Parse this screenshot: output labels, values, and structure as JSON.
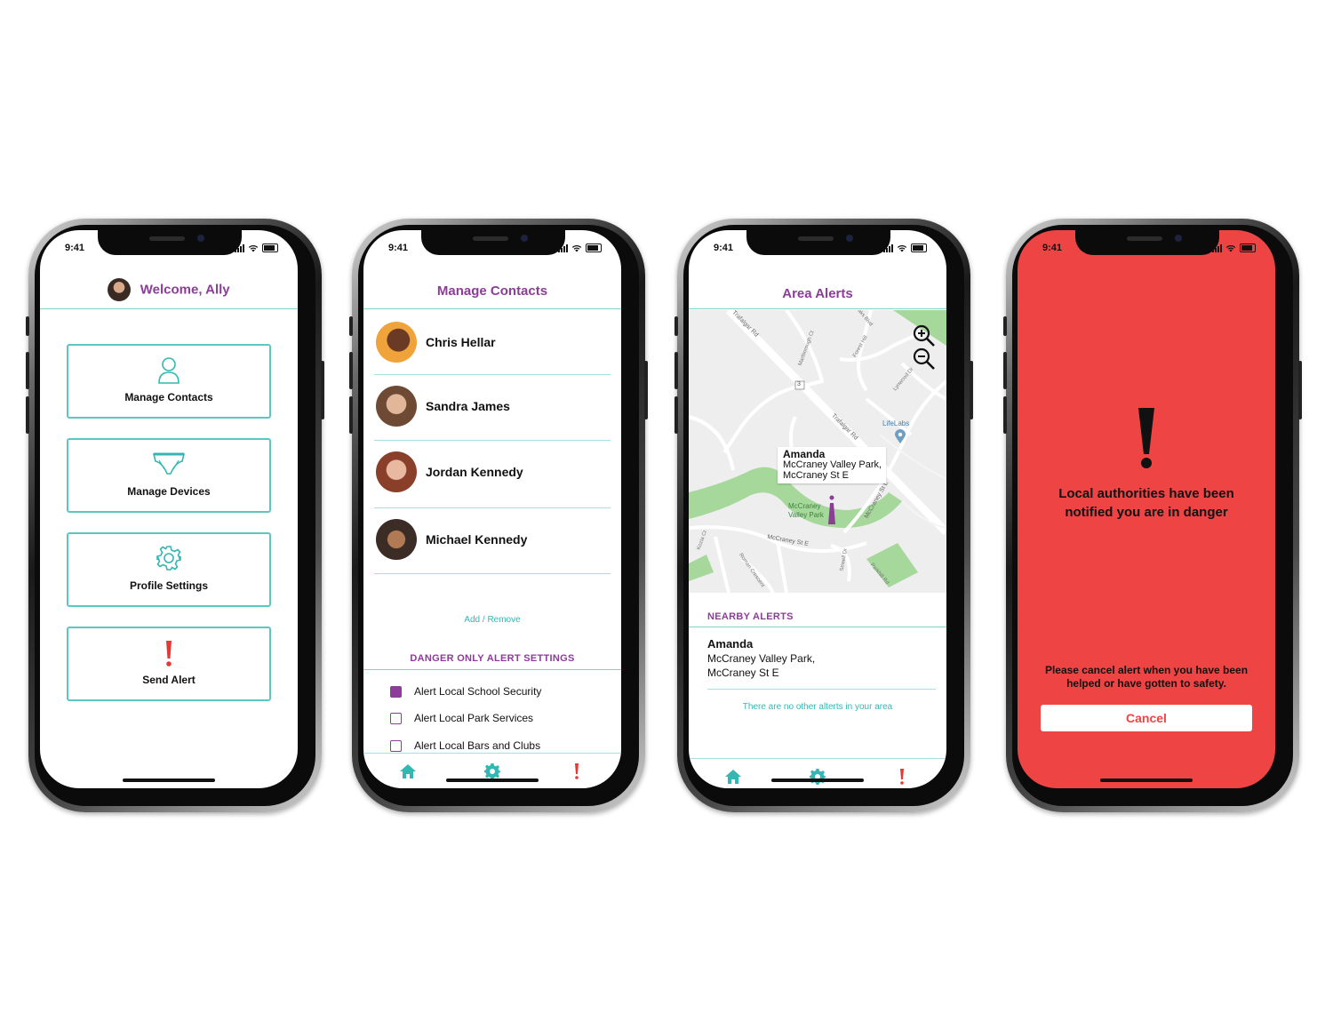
{
  "status_time": "9:41",
  "colors": {
    "purple": "#8b3d97",
    "teal": "#34b7b3",
    "alert_red": "#ef4444"
  },
  "screen1": {
    "title": "Welcome, Ally",
    "menu": [
      {
        "label": "Manage Contacts",
        "icon": "person-icon"
      },
      {
        "label": "Manage Devices",
        "icon": "underwear-icon"
      },
      {
        "label": "Profile Settings",
        "icon": "gear-icon"
      },
      {
        "label": "Send Alert",
        "icon": "exclamation-icon"
      }
    ]
  },
  "screen2": {
    "title": "Manage Contacts",
    "contacts": [
      {
        "name": "Chris Hellar"
      },
      {
        "name": "Sandra James"
      },
      {
        "name": "Jordan Kennedy"
      },
      {
        "name": "Michael Kennedy"
      }
    ],
    "add_remove": "Add / Remove",
    "settings_header": "DANGER ONLY ALERT SETTINGS",
    "settings": [
      {
        "label": "Alert Local School Security",
        "checked": true
      },
      {
        "label": "Alert Local Park Services",
        "checked": false
      },
      {
        "label": "Alert Local Bars and Clubs",
        "checked": false
      }
    ],
    "tabs": [
      "home-icon",
      "gear-icon",
      "alert-icon"
    ]
  },
  "screen3": {
    "title": "Area Alerts",
    "map": {
      "popup_name": "Amanda",
      "popup_line1": "McCraney Valley Park,",
      "popup_line2": "McCraney St E",
      "poi": "LifeLabs",
      "park_label_1": "McCraney",
      "park_label_2": "Valley Park",
      "streets": [
        "Trafalgar Rd",
        "Trafalgar Rd",
        "McCraney St E",
        "McCraney St E",
        "Forest Hill",
        "Marlborough Ct",
        "Lynwood Dr",
        "Kozia Ct",
        "Roman Crescent",
        "Sewell Dr",
        "Parkhill Rd",
        "Oaks Blvd"
      ],
      "route_marker": "3"
    },
    "nearby_header": "NEARBY ALERTS",
    "nearby": {
      "name": "Amanda",
      "line1": "McCraney Valley Park,",
      "line2": "McCraney St E"
    },
    "no_other": "There are no other alterts in your area"
  },
  "screen4": {
    "message": "Local authorities have been notified you are in danger",
    "cancel_note": "Please cancel alert when you have been helped or have gotten to safety.",
    "cancel_label": "Cancel"
  }
}
